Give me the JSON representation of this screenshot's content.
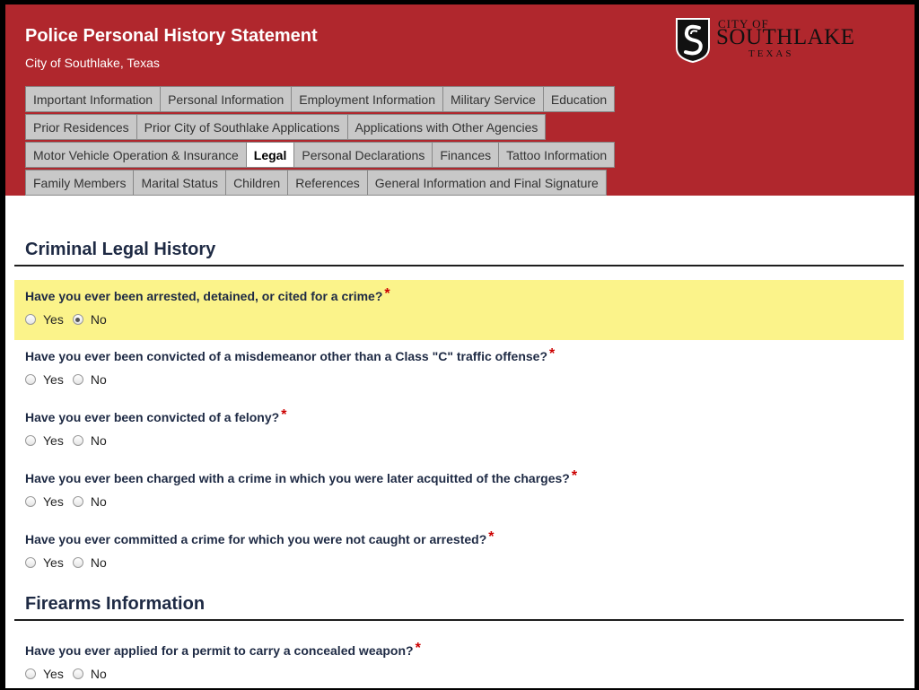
{
  "header": {
    "title": "Police Personal History Statement",
    "subtitle": "City of Southlake, Texas",
    "logo": {
      "city_of": "CITY OF",
      "name": "SOUTHLAKE",
      "state": "TEXAS",
      "icon": "southlake-shield-icon"
    }
  },
  "tabs": [
    [
      {
        "label": "Important Information",
        "active": false
      },
      {
        "label": "Personal Information",
        "active": false
      },
      {
        "label": "Employment Information",
        "active": false
      },
      {
        "label": "Military Service",
        "active": false
      },
      {
        "label": "Education",
        "active": false
      }
    ],
    [
      {
        "label": "Prior Residences",
        "active": false
      },
      {
        "label": "Prior City of Southlake Applications",
        "active": false
      },
      {
        "label": "Applications with Other Agencies",
        "active": false
      }
    ],
    [
      {
        "label": "Motor Vehicle Operation & Insurance",
        "active": false
      },
      {
        "label": "Legal",
        "active": true
      },
      {
        "label": "Personal Declarations",
        "active": false
      },
      {
        "label": "Finances",
        "active": false
      },
      {
        "label": "Tattoo Information",
        "active": false
      }
    ],
    [
      {
        "label": "Family Members",
        "active": false
      },
      {
        "label": "Marital Status",
        "active": false
      },
      {
        "label": "Children",
        "active": false
      },
      {
        "label": "References",
        "active": false
      },
      {
        "label": "General Information and Final Signature",
        "active": false
      }
    ]
  ],
  "sections": {
    "criminal": "Criminal Legal History",
    "firearms": "Firearms Information"
  },
  "required_marker": "*",
  "options": {
    "yes": "Yes",
    "no": "No"
  },
  "questions": [
    {
      "text": "Have you ever been arrested, detained, or cited for a crime?",
      "selected": "No",
      "highlighted": true
    },
    {
      "text": "Have you ever been convicted of a misdemeanor other than a Class \"C\" traffic offense?",
      "selected": null,
      "highlighted": false
    },
    {
      "text": "Have you ever been convicted of a felony?",
      "selected": null,
      "highlighted": false
    },
    {
      "text": "Have you ever been charged with a crime in which you were later acquitted of the charges?",
      "selected": null,
      "highlighted": false
    },
    {
      "text": "Have you ever committed a crime for which you were not caught or arrested?",
      "selected": null,
      "highlighted": false
    },
    {
      "text": "Have you ever applied for a permit to carry a concealed weapon?",
      "selected": null,
      "highlighted": false
    }
  ],
  "colors": {
    "header_bg": "#b0272d",
    "highlight": "#fbf38a",
    "required": "#cc0000",
    "heading": "#1e2a44"
  }
}
